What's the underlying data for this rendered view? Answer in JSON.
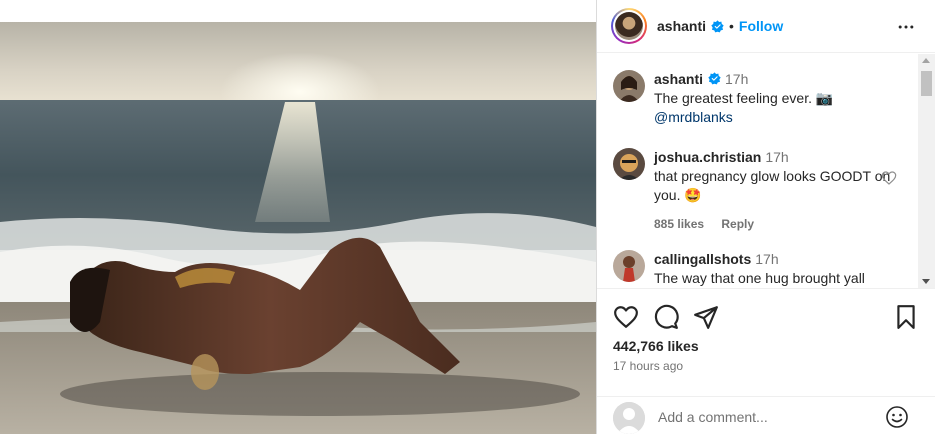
{
  "header": {
    "username": "ashanti",
    "separator": "•",
    "follow_label": "Follow"
  },
  "comments": [
    {
      "user": "ashanti",
      "time": "17h",
      "text": "The greatest feeling ever. 📷",
      "mention": "@mrdblanks"
    },
    {
      "user": "joshua.christian",
      "time": "17h",
      "text": "that pregnancy glow looks GOODT on you. 🤩",
      "likes": "885 likes",
      "reply": "Reply"
    },
    {
      "user": "callingallshots",
      "time": "17h",
      "text": "The way that one hug brought yall"
    }
  ],
  "stats": {
    "likes": "442,766 likes",
    "time_ago": "17 hours ago"
  },
  "add_comment": {
    "placeholder": "Add a comment..."
  },
  "icons": {
    "verified": "verified-badge-icon",
    "more": "more-options-icon",
    "like": "heart-icon",
    "comment": "comment-icon",
    "share": "share-icon",
    "save": "bookmark-icon",
    "emoji": "emoji-icon"
  },
  "colors": {
    "accent": "#0095f6",
    "mention": "#00376b",
    "muted": "#737373",
    "text": "#262626"
  }
}
